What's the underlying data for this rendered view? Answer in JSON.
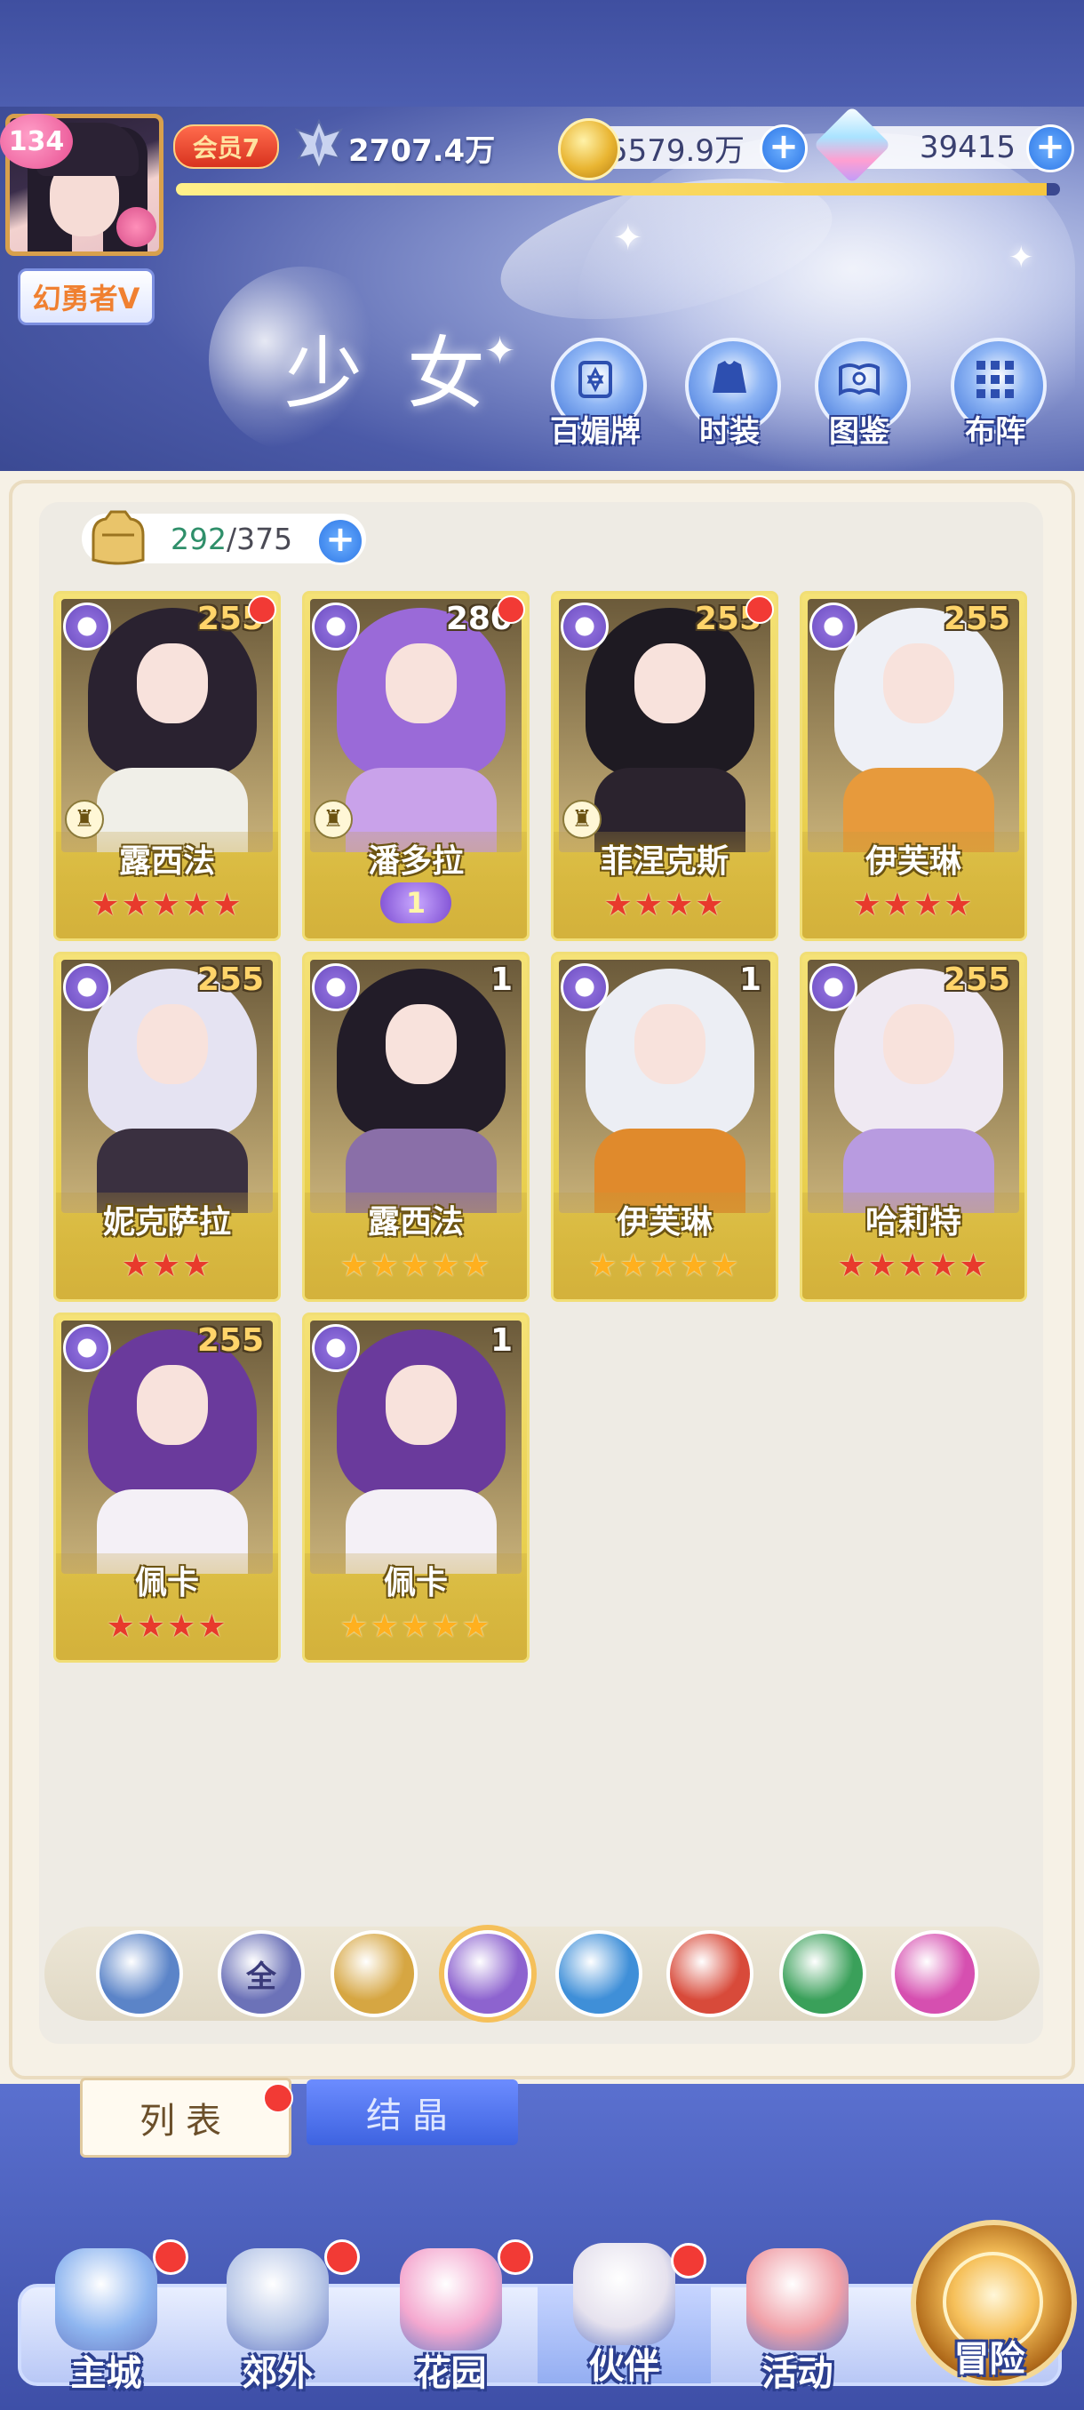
{
  "header": {
    "player_level": "134",
    "player_title": "幻勇者V",
    "vip_label": "会员7",
    "power": "2707.4万",
    "coins": "5579.9万",
    "gems": "39415",
    "xp_fraction": 0.985,
    "section_title": "少女",
    "buttons": [
      {
        "label": "百媚牌",
        "icon": "card-deck-icon"
      },
      {
        "label": "时装",
        "icon": "fashion-icon"
      },
      {
        "label": "图鉴",
        "icon": "book-icon"
      },
      {
        "label": "布阵",
        "icon": "formation-grid-icon"
      }
    ]
  },
  "capacity": {
    "current": "292",
    "max": "375",
    "separator": "/"
  },
  "characters": [
    {
      "name": "露西法",
      "level": "255",
      "stars": 5,
      "star_color": "red",
      "red_dot": true,
      "chess": true,
      "hair": "#2a2230",
      "clothes": "#f0efe8"
    },
    {
      "name": "潘多拉",
      "level": "280",
      "stars": 0,
      "star_color": "none",
      "red_dot": true,
      "chess": true,
      "badge": "1",
      "hair": "#9a6ad8",
      "clothes": "#c9a2ea"
    },
    {
      "name": "菲涅克斯",
      "level": "255",
      "stars": 4,
      "star_color": "red",
      "red_dot": true,
      "chess": true,
      "hair": "#1e1a22",
      "clothes": "#2b232e"
    },
    {
      "name": "伊芙琳",
      "level": "255",
      "stars": 4,
      "star_color": "red",
      "red_dot": false,
      "chess": false,
      "hair": "#eef0f6",
      "clothes": "#e79a3c"
    },
    {
      "name": "妮克萨拉",
      "level": "255",
      "stars": 3,
      "star_color": "red",
      "red_dot": false,
      "chess": false,
      "hair": "#e5e3f2",
      "clothes": "#3a3040"
    },
    {
      "name": "露西法",
      "level": "1",
      "stars": 5,
      "star_color": "gold",
      "red_dot": false,
      "chess": false,
      "hair": "#221c28",
      "clothes": "#8a6fa8"
    },
    {
      "name": "伊芙琳",
      "level": "1",
      "stars": 5,
      "star_color": "gold",
      "red_dot": false,
      "chess": false,
      "hair": "#eceef4",
      "clothes": "#e08a2c"
    },
    {
      "name": "哈莉特",
      "level": "255",
      "stars": 5,
      "star_color": "red",
      "red_dot": false,
      "chess": false,
      "hair": "#efe9f2",
      "clothes": "#b89be0"
    },
    {
      "name": "佩卡",
      "level": "255",
      "stars": 4,
      "star_color": "red",
      "red_dot": false,
      "chess": false,
      "hair": "#6a3a9c",
      "clothes": "#f4f0f6"
    },
    {
      "name": "佩卡",
      "level": "1",
      "stars": 5,
      "star_color": "gold",
      "red_dot": false,
      "chess": false,
      "hair": "#6a3a9c",
      "clothes": "#f4f0f6"
    }
  ],
  "filters": [
    {
      "icon": "angel-wing-icon",
      "label": "",
      "color": "#5b84c8"
    },
    {
      "icon": "all-icon",
      "label": "全",
      "color": "#6c72b8"
    },
    {
      "icon": "sun-icon",
      "label": "",
      "color": "#d6a642"
    },
    {
      "icon": "moon-icon",
      "label": "",
      "color": "#8d63cf"
    },
    {
      "icon": "water-drop-icon",
      "label": "",
      "color": "#3f8fd8"
    },
    {
      "icon": "fire-icon",
      "label": "",
      "color": "#d84a3a"
    },
    {
      "icon": "wind-icon",
      "label": "",
      "color": "#3aa05a"
    },
    {
      "icon": "planet-icon",
      "label": "",
      "color": "#d64fb0"
    }
  ],
  "tabs": {
    "list": "列表",
    "crystal": "结晶"
  },
  "nav": [
    {
      "label": "主城",
      "icon": "castle-icon",
      "dot": true,
      "color": "#8fb6f0"
    },
    {
      "label": "郊外",
      "icon": "portal-icon",
      "dot": true,
      "color": "#b9c8e8"
    },
    {
      "label": "花园",
      "icon": "heart-garden-icon",
      "dot": true,
      "color": "#f4a8cf"
    },
    {
      "label": "伙伴",
      "icon": "partner-portrait-icon",
      "dot": true,
      "color": "#e6e2ee"
    },
    {
      "label": "活动",
      "icon": "gift-box-icon",
      "dot": false,
      "color": "#f0a0a8"
    },
    {
      "label": "冒险",
      "icon": "adventure-compass-icon",
      "dot": false,
      "color": "#f2c15c"
    }
  ],
  "colors": {
    "accent_blue": "#3e63e0",
    "card_gold": "#e3c63b",
    "red_dot": "#f23a35",
    "panel_bg": "#eeebe4"
  }
}
